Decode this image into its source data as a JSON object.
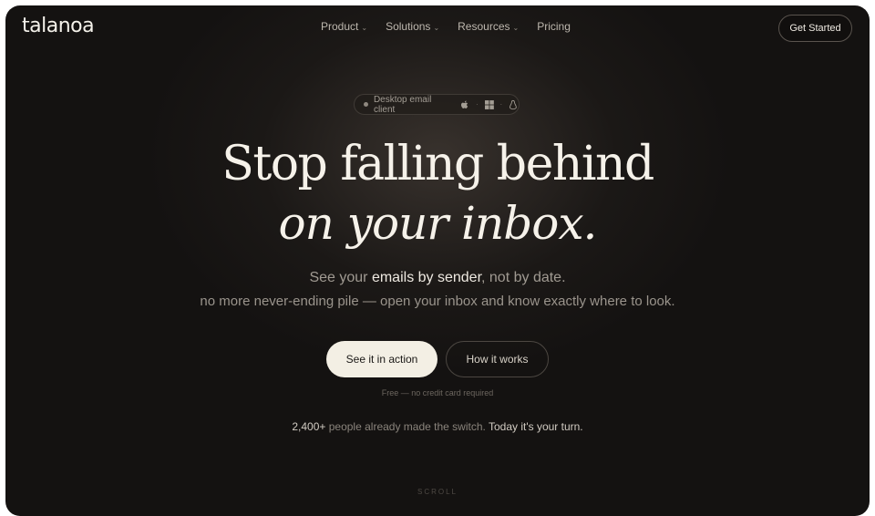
{
  "brand": {
    "logo": "talanoa"
  },
  "nav": {
    "items": [
      {
        "label": "Product",
        "has_dropdown": true
      },
      {
        "label": "Solutions",
        "has_dropdown": true
      },
      {
        "label": "Resources",
        "has_dropdown": true
      },
      {
        "label": "Pricing",
        "has_dropdown": false
      }
    ],
    "cta": "Get Started"
  },
  "badge": {
    "label": "Desktop email client",
    "platform_icons": [
      "apple-icon",
      "windows-icon",
      "linux-icon"
    ]
  },
  "hero": {
    "line1": "Stop falling behind",
    "line2": "on your inbox.",
    "sub1_pre": "See your ",
    "sub1_highlight": "emails by sender",
    "sub1_post": ", not by date.",
    "sub2": "no more never-ending pile — open your inbox and know exactly where to look."
  },
  "actions": {
    "primary": "See it in action",
    "secondary": "How it works",
    "note": "Free — no credit card required"
  },
  "social_proof": {
    "count": "2,400+",
    "text": " people already made the switch. ",
    "cta": "Today it's your turn."
  },
  "scroll_hint": "SCROLL",
  "colors": {
    "background": "#141211",
    "accent": "#f3efe4",
    "text": "#f6f2ea"
  }
}
